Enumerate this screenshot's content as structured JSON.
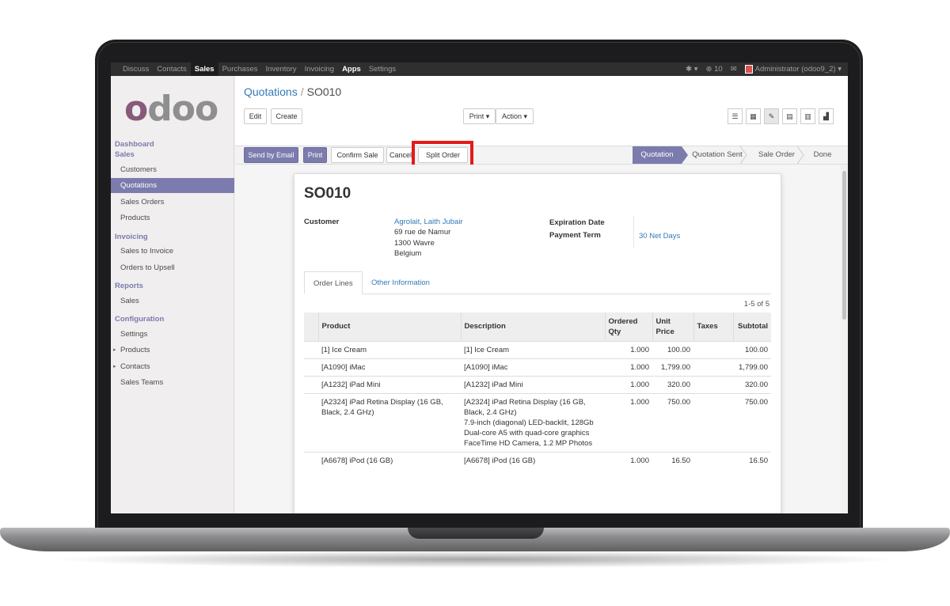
{
  "topbar": {
    "menu": [
      "Discuss",
      "Contacts",
      "Sales",
      "Purchases",
      "Inventory",
      "Invoicing",
      "Apps",
      "Settings"
    ],
    "bug_icon": "bug-icon",
    "notification_count": "10",
    "chat_icon": "chat-icon",
    "user": "Administrator (odoo9_2)"
  },
  "logo": {
    "text_first": "o",
    "text_rest": "doo"
  },
  "sidebar": {
    "dashboard": "Dashboard",
    "sales_head": "Sales",
    "customers": "Customers",
    "quotations": "Quotations",
    "sales_orders": "Sales Orders",
    "products": "Products",
    "invoicing_head": "Invoicing",
    "sales_to_invoice": "Sales to Invoice",
    "orders_to_upsell": "Orders to Upsell",
    "reports_head": "Reports",
    "reports_sales": "Sales",
    "configuration_head": "Configuration",
    "settings": "Settings",
    "config_products": "Products",
    "contacts": "Contacts",
    "sales_teams": "Sales Teams"
  },
  "breadcrumb": {
    "parent": "Quotations",
    "separator": "/",
    "current": "SO010"
  },
  "control": {
    "edit": "Edit",
    "create": "Create",
    "print": "Print ▾",
    "action": "Action ▾"
  },
  "header_buttons": {
    "send_by_email": "Send by Email",
    "print": "Print",
    "confirm_sale": "Confirm Sale",
    "cancel": "Cancel",
    "split_order": "Split Order"
  },
  "stages": [
    "Quotation",
    "Quotation Sent",
    "Sale Order",
    "Done"
  ],
  "order": {
    "name": "SO010",
    "customer_label": "Customer",
    "customer_name": "Agrolait, Laith Jubair",
    "address_line1": "69 rue de Namur",
    "address_line2": "1300 Wavre",
    "address_line3": "Belgium",
    "expiration_label": "Expiration Date",
    "payment_term_label": "Payment Term",
    "payment_term": "30 Net Days"
  },
  "tabs": {
    "order_lines": "Order Lines",
    "other_info": "Other Information"
  },
  "pager": "1-5 of 5",
  "table": {
    "headers": {
      "product": "Product",
      "description": "Description",
      "qty": "Ordered Qty",
      "unit_price": "Unit Price",
      "taxes": "Taxes",
      "subtotal": "Subtotal"
    },
    "rows": [
      {
        "product": "[1] Ice Cream",
        "description": "[1] Ice Cream",
        "qty": "1.000",
        "price": "100.00",
        "subtotal": "100.00"
      },
      {
        "product": "[A1090] iMac",
        "description": "[A1090] iMac",
        "qty": "1.000",
        "price": "1,799.00",
        "subtotal": "1,799.00"
      },
      {
        "product": "[A1232] iPad Mini",
        "description": "[A1232] iPad Mini",
        "qty": "1.000",
        "price": "320.00",
        "subtotal": "320.00"
      },
      {
        "product": "[A2324] iPad Retina Display (16 GB, Black, 2.4 GHz)",
        "description": "[A2324] iPad Retina Display (16 GB, Black, 2.4 GHz)\n7.9-inch (diagonal) LED-backlit, 128Gb\nDual-core A5 with quad-core graphics\nFaceTime HD Camera, 1.2 MP Photos",
        "qty": "1.000",
        "price": "750.00",
        "subtotal": "750.00"
      },
      {
        "product": "[A6678] iPod (16 GB)",
        "description": "[A6678] iPod (16 GB)",
        "qty": "1.000",
        "price": "16.50",
        "subtotal": "16.50"
      }
    ]
  },
  "colors": {
    "brand": "#875a7b",
    "accent": "#7c7bad",
    "link": "#337ab7",
    "highlight": "#e31a1c"
  }
}
